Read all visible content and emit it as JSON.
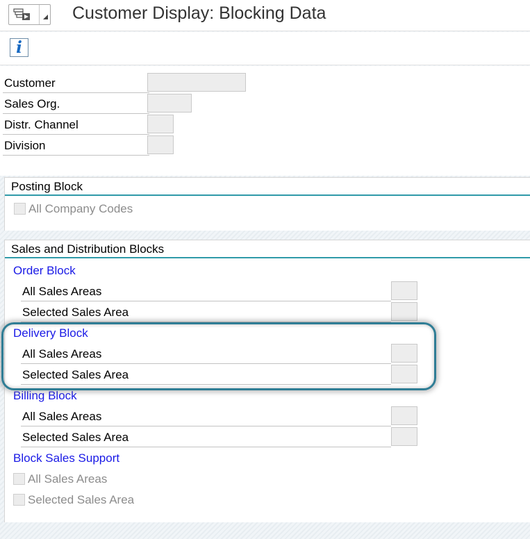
{
  "app": {
    "title": "Customer Display: Blocking Data"
  },
  "icons": {
    "menu": "menu-icon",
    "dropdown": "triangle-down-icon",
    "info": "info-icon"
  },
  "colors": {
    "accent_line": "#2f9aa9",
    "subsection_blue": "#1a1ae6",
    "highlight_frame": "#2f7d95",
    "field_bg": "#ededed"
  },
  "toolbar": {
    "info_symbol": "i"
  },
  "header_fields": [
    {
      "label": "Customer",
      "value": ""
    },
    {
      "label": "Sales Org.",
      "value": ""
    },
    {
      "label": "Distr. Channel",
      "value": ""
    },
    {
      "label": "Division",
      "value": ""
    }
  ],
  "posting_block": {
    "title": "Posting Block",
    "all_company_codes": {
      "label": "All Company Codes",
      "checked": false
    }
  },
  "sd_blocks": {
    "title": "Sales and Distribution Blocks",
    "order_block": {
      "title": "Order Block",
      "rows": [
        {
          "label": "All Sales Areas",
          "value": ""
        },
        {
          "label": "Selected Sales Area",
          "value": ""
        }
      ]
    },
    "delivery_block": {
      "title": "Delivery Block",
      "rows": [
        {
          "label": "All Sales Areas",
          "value": ""
        },
        {
          "label": "Selected Sales Area",
          "value": ""
        }
      ]
    },
    "billing_block": {
      "title": "Billing Block",
      "rows": [
        {
          "label": "All Sales Areas",
          "value": ""
        },
        {
          "label": "Selected Sales Area",
          "value": ""
        }
      ]
    },
    "block_sales_support": {
      "title": "Block Sales Support",
      "checkboxes": [
        {
          "label": "All Sales Areas",
          "checked": false
        },
        {
          "label": "Selected Sales Area",
          "checked": false
        }
      ]
    }
  }
}
